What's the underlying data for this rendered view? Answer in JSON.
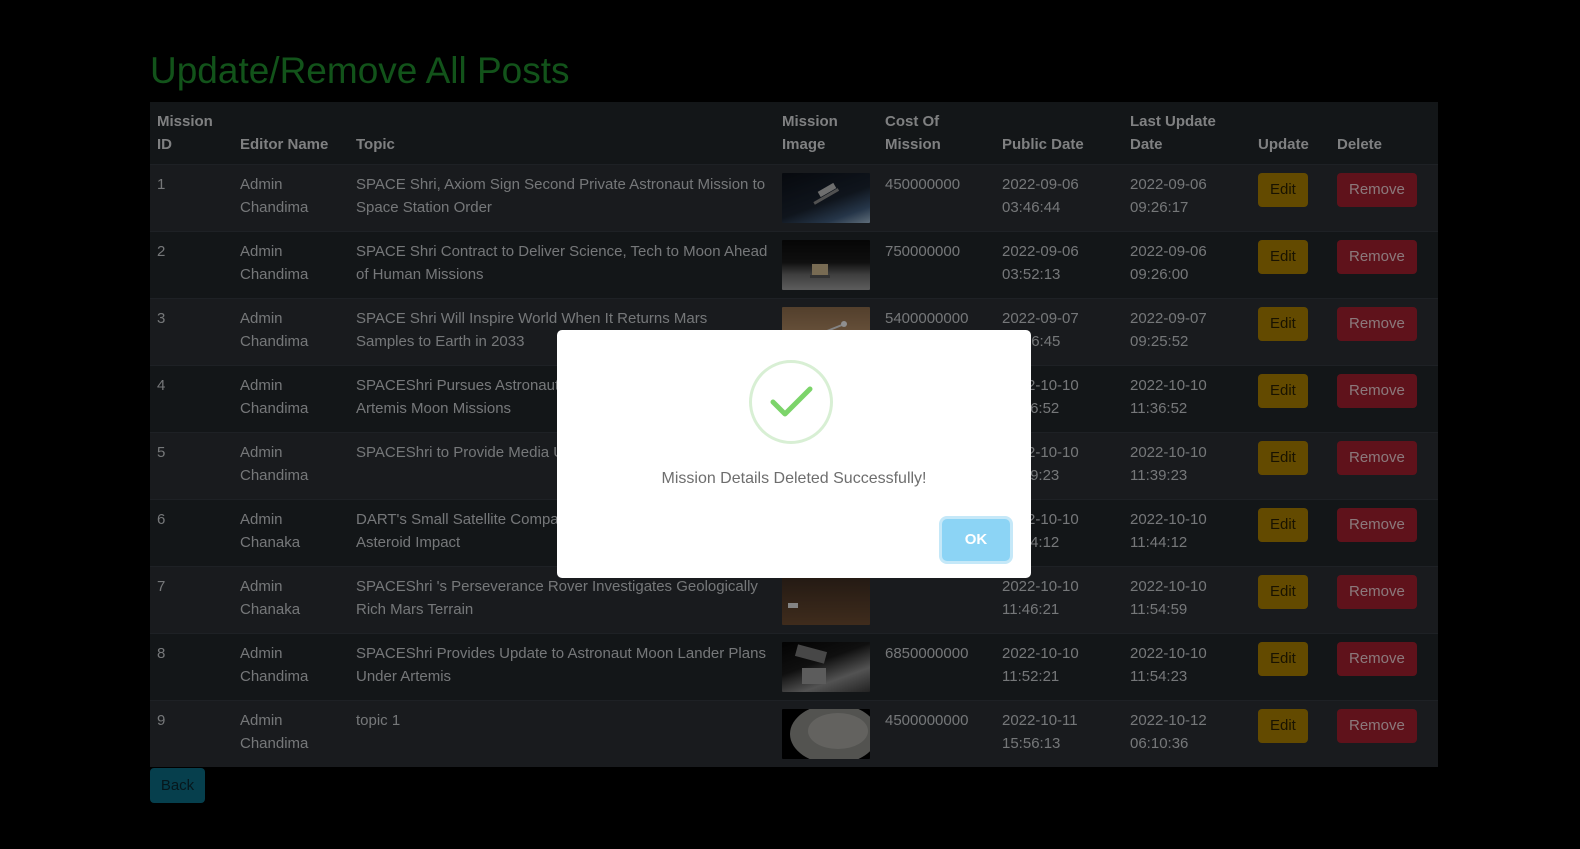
{
  "page": {
    "title": "Update/Remove All Posts",
    "back_label": "Back"
  },
  "table": {
    "headers": {
      "id": "Mission ID",
      "editor": "Editor Name",
      "topic": "Topic",
      "image": "Mission Image",
      "cost": "Cost Of Mission",
      "public_date": "Public Date",
      "last_update": "Last Update Date",
      "update": "Update",
      "delete": "Delete"
    },
    "edit_label": "Edit",
    "remove_label": "Remove",
    "rows": [
      {
        "id": "1",
        "editor": "Admin Chandima",
        "topic": "SPACE Shri, Axiom Sign Second Private Astronaut Mission to Space Station Order",
        "image": "space-station-image",
        "cost": "450000000",
        "public_date": "2022-09-06 03:46:44",
        "last_update": "2022-09-06 09:26:17"
      },
      {
        "id": "2",
        "editor": "Admin Chandima",
        "topic": "SPACE Shri Contract to Deliver Science, Tech to Moon Ahead of Human Missions",
        "image": "moon-lander-image",
        "cost": "750000000",
        "public_date": "2022-09-06 03:52:13",
        "last_update": "2022-09-06 09:26:00"
      },
      {
        "id": "3",
        "editor": "Admin Chandima",
        "topic": "SPACE Shri Will Inspire World When It Returns Mars Samples to Earth in 2033",
        "image": "mars-sample-image",
        "cost": "5400000000",
        "public_date": "2022-09-07 03:56:45",
        "last_update": "2022-09-07 09:25:52"
      },
      {
        "id": "4",
        "editor": "Admin Chandima",
        "topic": "SPACEShri Pursues Astronaut Lunar Terrain Vehicle for Artemis Moon Missions",
        "image": "lunar-vehicle-image",
        "cost": "",
        "public_date": "2022-10-10 11:36:52",
        "last_update": "2022-10-10 11:36:52"
      },
      {
        "id": "5",
        "editor": "Admin Chandima",
        "topic": "SPACEShri to Provide Media Updates",
        "image": "media-update-image",
        "cost": "",
        "public_date": "2022-10-10 11:39:23",
        "last_update": "2022-10-10 11:39:23"
      },
      {
        "id": "6",
        "editor": "Admin Chanaka",
        "topic": "DART's Small Satellite Companion Captures Images of Asteroid Impact",
        "image": "dart-satellite-image",
        "cost": "",
        "public_date": "2022-10-10 11:44:12",
        "last_update": "2022-10-10 11:44:12"
      },
      {
        "id": "7",
        "editor": "Admin Chanaka",
        "topic": "SPACEShri 's Perseverance Rover Investigates Geologically Rich Mars Terrain",
        "image": "perseverance-rover-image",
        "cost": "",
        "public_date": "2022-10-10 11:46:21",
        "last_update": "2022-10-10 11:54:59"
      },
      {
        "id": "8",
        "editor": "Admin Chandima",
        "topic": "SPACEShri Provides Update to Astronaut Moon Lander Plans Under Artemis",
        "image": "moon-lander-plans-image",
        "cost": "6850000000",
        "public_date": "2022-10-10 11:52:21",
        "last_update": "2022-10-10 11:54:23"
      },
      {
        "id": "9",
        "editor": "Admin Chandima",
        "topic": "topic 1",
        "image": "moon-surface-image",
        "cost": "4500000000",
        "public_date": "2022-10-11 15:56:13",
        "last_update": "2022-10-12 06:10:36"
      }
    ]
  },
  "modal": {
    "icon": "checkmark-icon",
    "message": "Mission Details Deleted Successfully!",
    "ok_label": "OK"
  },
  "colors": {
    "title": "#1e8a2c",
    "edit": "#a67c00",
    "remove": "#9e1f2d",
    "back": "#0a6a80",
    "ok": "#8cd4f5",
    "success": "#7cd46a"
  }
}
